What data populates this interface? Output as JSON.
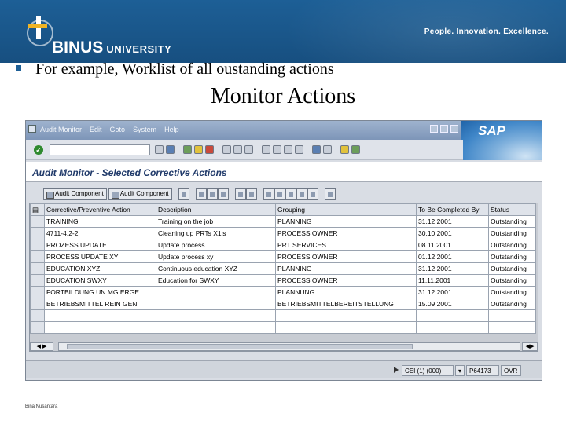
{
  "slide": {
    "brand": "BINUS",
    "brand_suffix": "UNIVERSITY",
    "tagline": "People. Innovation. Excellence.",
    "bullet": "For example, Worklist of all oustanding actions",
    "title": "Monitor Actions",
    "footer": "Bina Nusantara"
  },
  "sap": {
    "menu": [
      "Audit Monitor",
      "Edit",
      "Goto",
      "System",
      "Help"
    ],
    "logo": "SAP",
    "screen_title": "Audit Monitor - Selected Corrective Actions",
    "app_buttons": [
      "Audit Component",
      "Audit Component"
    ],
    "columns": [
      "Corrective/Preventive Action",
      "Description",
      "Grouping",
      "To Be Completed By",
      "Status"
    ],
    "rows": [
      [
        "TRAINING",
        "Training on the job",
        "PLANNING",
        "31.12.2001",
        "Outstanding"
      ],
      [
        "4711-4.2-2",
        "Cleaning up PRTs X1's",
        "PROCESS OWNER",
        "30.10.2001",
        "Outstanding"
      ],
      [
        "PROZESS UPDATE",
        "Update process",
        "PRT SERVICES",
        "08.11.2001",
        "Outstanding"
      ],
      [
        "PROCESS UPDATE XY",
        "Update process xy",
        "PROCESS OWNER",
        "01.12.2001",
        "Outstanding"
      ],
      [
        "EDUCATION XYZ",
        "Continuous education XYZ",
        "PLANNING",
        "31.12.2001",
        "Outstanding"
      ],
      [
        "EDUCATION SWXY",
        "Education for SWXY",
        "PROCESS OWNER",
        "11.11.2001",
        "Outstanding"
      ],
      [
        "FORTBILDUNG UN MG ERGE",
        "",
        "PLANNUNG",
        "31.12.2001",
        "Outstanding"
      ],
      [
        "BETRIEBSMITTEL REIN GEN",
        "",
        "BETRIEBSMITTELBEREITSTELLUNG",
        "15.09.2001",
        "Outstanding"
      ]
    ],
    "status": {
      "system": "CEI (1) (000)",
      "client": "P64173",
      "mode": "OVR"
    }
  }
}
